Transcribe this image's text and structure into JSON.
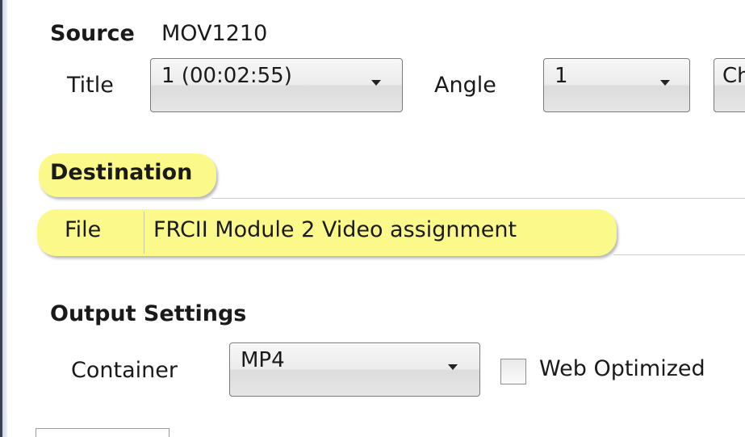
{
  "source": {
    "label": "Source",
    "value": "MOV1210"
  },
  "title_field": {
    "label": "Title",
    "value": "1 (00:02:55)"
  },
  "angle_field": {
    "label": "Angle",
    "value": "1"
  },
  "chapters_field": {
    "partial_value": "Ch"
  },
  "destination": {
    "heading": "Destination",
    "file_label": "File",
    "file_value": "FRCII Module 2 Video assignment"
  },
  "output_settings": {
    "heading": "Output Settings",
    "container_label": "Container",
    "container_value": "MP4",
    "web_optimized_label": "Web Optimized",
    "web_optimized_checked": false
  },
  "icons": {
    "dropdown": "chevron-down-icon"
  },
  "colors": {
    "highlight": "#fbf98a",
    "combo_border": "#7a7a7a"
  }
}
